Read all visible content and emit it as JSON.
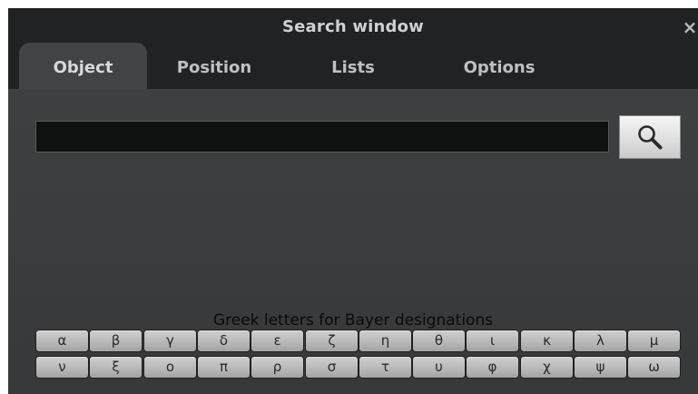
{
  "window": {
    "title": "Search window",
    "close_glyph": "×"
  },
  "tabs": [
    {
      "label": "Object",
      "active": true
    },
    {
      "label": "Position",
      "active": false
    },
    {
      "label": "Lists",
      "active": false
    },
    {
      "label": "Options",
      "active": false
    }
  ],
  "search": {
    "value": "",
    "button_icon": "magnifier-icon"
  },
  "greek": {
    "label": "Greek letters for Bayer designations",
    "row1": [
      "α",
      "β",
      "γ",
      "δ",
      "ε",
      "ζ",
      "η",
      "θ",
      "ι",
      "κ",
      "λ",
      "μ"
    ],
    "row2": [
      "ν",
      "ξ",
      "ο",
      "π",
      "ρ",
      "σ",
      "τ",
      "υ",
      "φ",
      "χ",
      "ψ",
      "ω"
    ]
  },
  "colors": {
    "window_bg": "#3d3f41",
    "titlebar_bg": "#212223",
    "active_tab_bg": "#414345",
    "key_bg": "#bcbcbc"
  }
}
